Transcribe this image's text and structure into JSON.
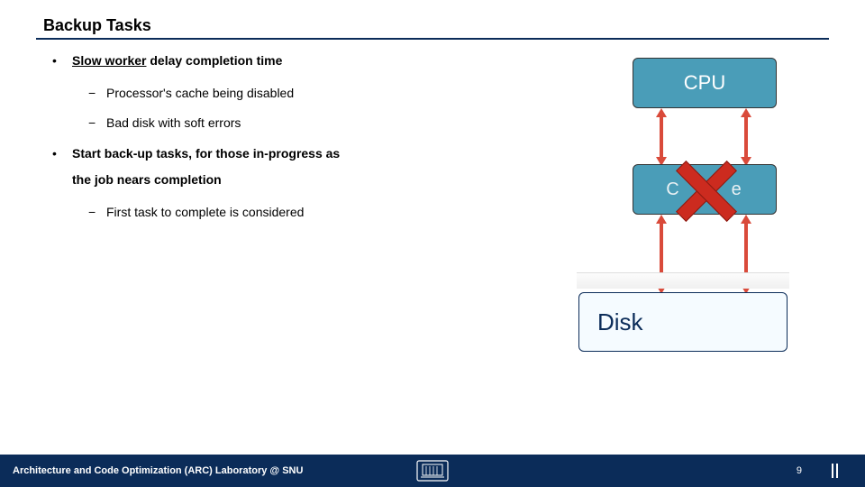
{
  "title": "Backup Tasks",
  "bullets": {
    "b1": {
      "strong": "Slow worker",
      "rest": " delay completion time"
    },
    "s1": "Processor's cache being disabled",
    "s2": "Bad disk with soft errors",
    "b2": {
      "strong": "Start back-up tasks,",
      "rest_line1": " for those in-progress as",
      "rest_line2": "the job nears completion"
    },
    "s3": "First task to complete is considered"
  },
  "diagram": {
    "cpu": "CPU",
    "cache": "Cache",
    "disk": "Disk"
  },
  "footer": {
    "lab": "Architecture and Code Optimization (ARC) Laboratory @ SNU",
    "page": "9"
  }
}
